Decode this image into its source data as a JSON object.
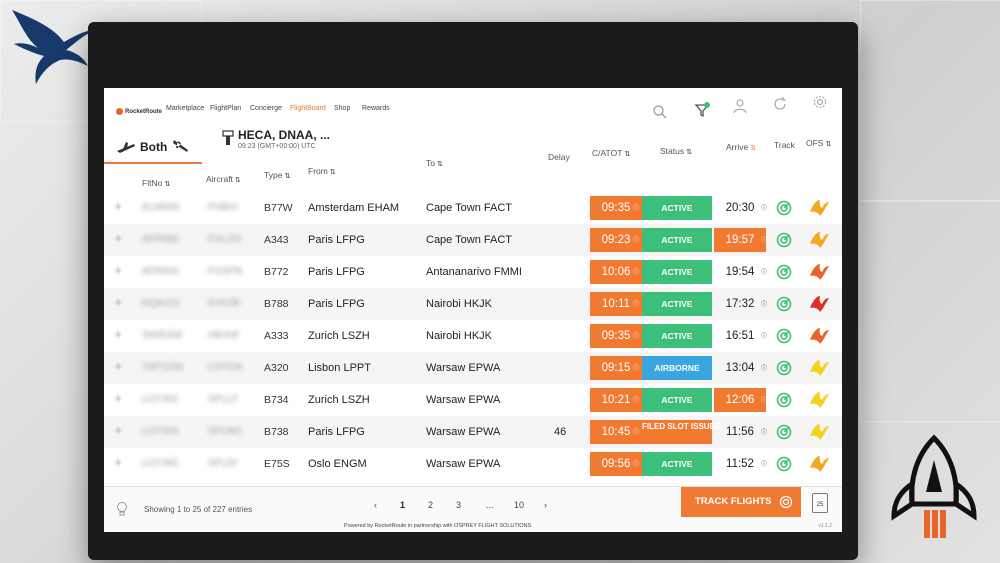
{
  "nav": {
    "brand": "RocketRoute",
    "items": [
      "Marketplace",
      "FlightPlan",
      "Concierge",
      "FlightBoard",
      "Shop",
      "Rewards"
    ],
    "active": "FlightBoard",
    "filter_badge": "1"
  },
  "mode": {
    "label": "Both"
  },
  "airport": {
    "codes": "HECA, DNAA, ...",
    "time": "09:23 (GMT+00:00) UTC"
  },
  "columns": {
    "fltno": "FltNo",
    "aircraft": "Aircraft",
    "type": "Type",
    "from": "From",
    "to": "To",
    "delay": "Delay",
    "atot": "C/ATOT",
    "status": "Status",
    "arrive": "Arrive",
    "track": "Track",
    "ofs": "OFS"
  },
  "rows": [
    {
      "type": "B77W",
      "from": "Amsterdam EHAM",
      "to": "Cape Town FACT",
      "delay": "",
      "atot": "09:35",
      "status": "ACTIVE",
      "arrive": "20:30",
      "arrive_late": false
    },
    {
      "type": "A343",
      "from": "Paris LFPG",
      "to": "Cape Town FACT",
      "delay": "",
      "atot": "09:23",
      "status": "ACTIVE",
      "arrive": "19:57",
      "arrive_late": true
    },
    {
      "type": "B772",
      "from": "Paris LFPG",
      "to": "Antananarivo FMMI",
      "delay": "",
      "atot": "10:06",
      "status": "ACTIVE",
      "arrive": "19:54",
      "arrive_late": false
    },
    {
      "type": "B788",
      "from": "Paris LFPG",
      "to": "Nairobi HKJK",
      "delay": "",
      "atot": "10:11",
      "status": "ACTIVE",
      "arrive": "17:32",
      "arrive_late": false
    },
    {
      "type": "A333",
      "from": "Zurich LSZH",
      "to": "Nairobi HKJK",
      "delay": "",
      "atot": "09:35",
      "status": "ACTIVE",
      "arrive": "16:51",
      "arrive_late": false
    },
    {
      "type": "A320",
      "from": "Lisbon LPPT",
      "to": "Warsaw EPWA",
      "delay": "",
      "atot": "09:15",
      "status": "AIRBORNE",
      "arrive": "13:04",
      "arrive_late": false
    },
    {
      "type": "B734",
      "from": "Zurich LSZH",
      "to": "Warsaw EPWA",
      "delay": "",
      "atot": "10:21",
      "status": "ACTIVE",
      "arrive": "12:06",
      "arrive_late": true
    },
    {
      "type": "B738",
      "from": "Paris LFPG",
      "to": "Warsaw EPWA",
      "delay": "46",
      "atot": "10:45",
      "status": "FILED SLOT ISSUED",
      "arrive": "11:56",
      "arrive_late": false
    },
    {
      "type": "E75S",
      "from": "Oslo ENGM",
      "to": "Warsaw EPWA",
      "delay": "",
      "atot": "09:56",
      "status": "ACTIVE",
      "arrive": "11:52",
      "arrive_late": false
    }
  ],
  "colors": {
    "accent": "#f07a32",
    "active": "#3cbf78",
    "airborne": "#3aa6e0",
    "filed": "#f07a32",
    "ofs_colors": [
      "#f5a623",
      "#f5a623",
      "#e8652a",
      "#d9312a",
      "#e8652a",
      "#f2d21c",
      "#f2d21c",
      "#f2d21c",
      "#f5a623"
    ]
  },
  "footer": {
    "showing": "Showing 1 to 25 of 227 entries",
    "pages": [
      "1",
      "2",
      "3",
      "10"
    ],
    "ellipsis": "...",
    "prev": "‹",
    "next": "›",
    "track_button": "TRACK FLIGHTS",
    "export_label": "25",
    "powered_by": "Powered by RocketRoute in partnership with OSPREY FLIGHT SOLUTIONS",
    "version": "v1.1.2"
  }
}
